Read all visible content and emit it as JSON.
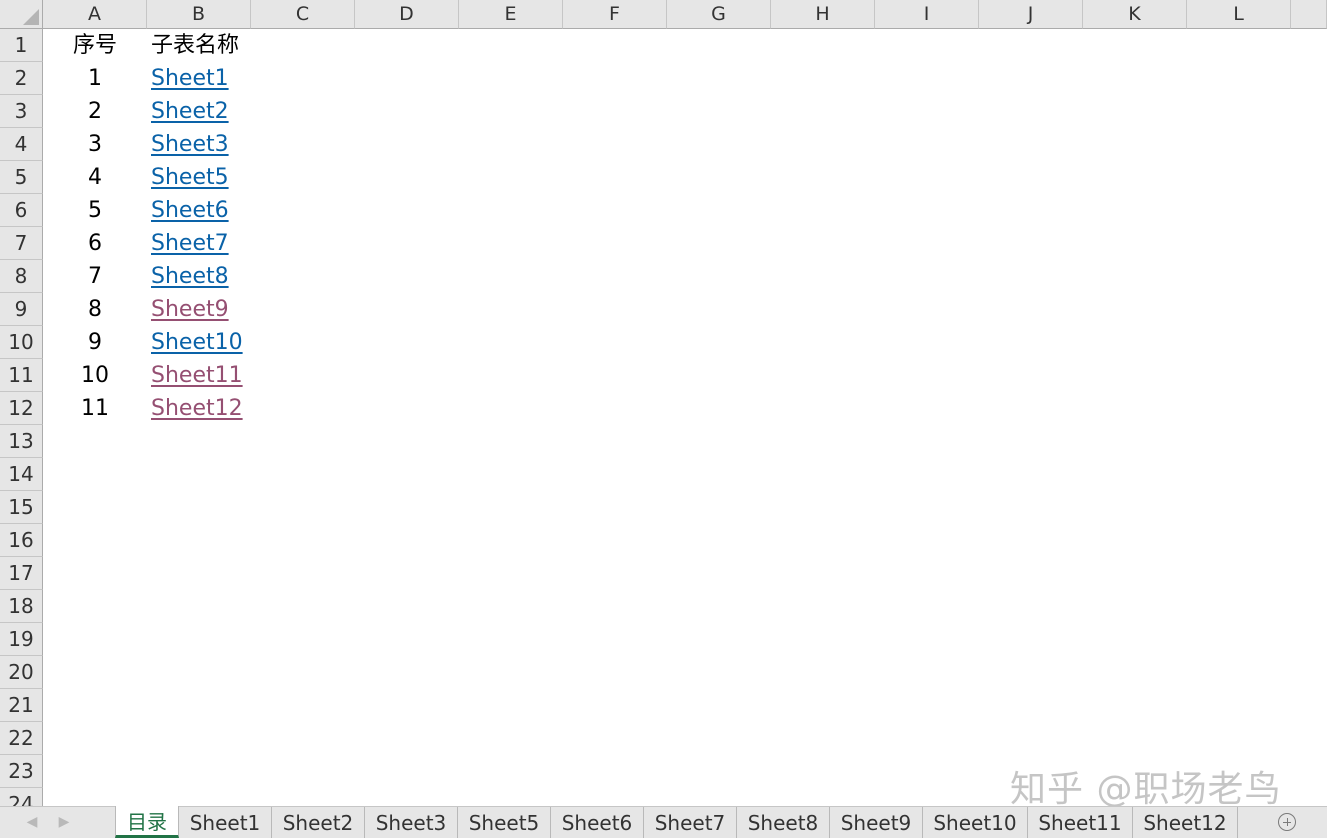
{
  "columns": [
    "A",
    "B",
    "C",
    "D",
    "E",
    "F",
    "G",
    "H",
    "I",
    "J",
    "K",
    "L"
  ],
  "rows": [
    "1",
    "2",
    "3",
    "4",
    "5",
    "6",
    "7",
    "8",
    "9",
    "10",
    "11",
    "12",
    "13",
    "14",
    "15",
    "16",
    "17",
    "18",
    "19",
    "20",
    "21",
    "22",
    "23",
    "24"
  ],
  "table": {
    "header": {
      "index": "序号",
      "name": "子表名称"
    },
    "entries": [
      {
        "index": "1",
        "name": "Sheet1",
        "visited": false
      },
      {
        "index": "2",
        "name": "Sheet2",
        "visited": false
      },
      {
        "index": "3",
        "name": "Sheet3",
        "visited": false
      },
      {
        "index": "4",
        "name": "Sheet5",
        "visited": false
      },
      {
        "index": "5",
        "name": "Sheet6",
        "visited": false
      },
      {
        "index": "6",
        "name": "Sheet7",
        "visited": false
      },
      {
        "index": "7",
        "name": "Sheet8",
        "visited": false
      },
      {
        "index": "8",
        "name": "Sheet9",
        "visited": true
      },
      {
        "index": "9",
        "name": "Sheet10",
        "visited": false
      },
      {
        "index": "10",
        "name": "Sheet11",
        "visited": true
      },
      {
        "index": "11",
        "name": "Sheet12",
        "visited": true
      }
    ]
  },
  "tabs": [
    {
      "label": "目录",
      "active": true
    },
    {
      "label": "Sheet1",
      "active": false
    },
    {
      "label": "Sheet2",
      "active": false
    },
    {
      "label": "Sheet3",
      "active": false
    },
    {
      "label": "Sheet5",
      "active": false
    },
    {
      "label": "Sheet6",
      "active": false
    },
    {
      "label": "Sheet7",
      "active": false
    },
    {
      "label": "Sheet8",
      "active": false
    },
    {
      "label": "Sheet9",
      "active": false
    },
    {
      "label": "Sheet10",
      "active": false
    },
    {
      "label": "Sheet11",
      "active": false
    },
    {
      "label": "Sheet12",
      "active": false
    }
  ],
  "icons": {
    "prev_sheet": "chevron-left-icon",
    "next_sheet": "chevron-right-icon",
    "add_sheet": "plus-circle-icon"
  },
  "watermark": "知乎 @职场老鸟",
  "colors": {
    "link_unvisited": "#0a62a8",
    "link_visited": "#954f72",
    "active_tab": "#217346"
  }
}
